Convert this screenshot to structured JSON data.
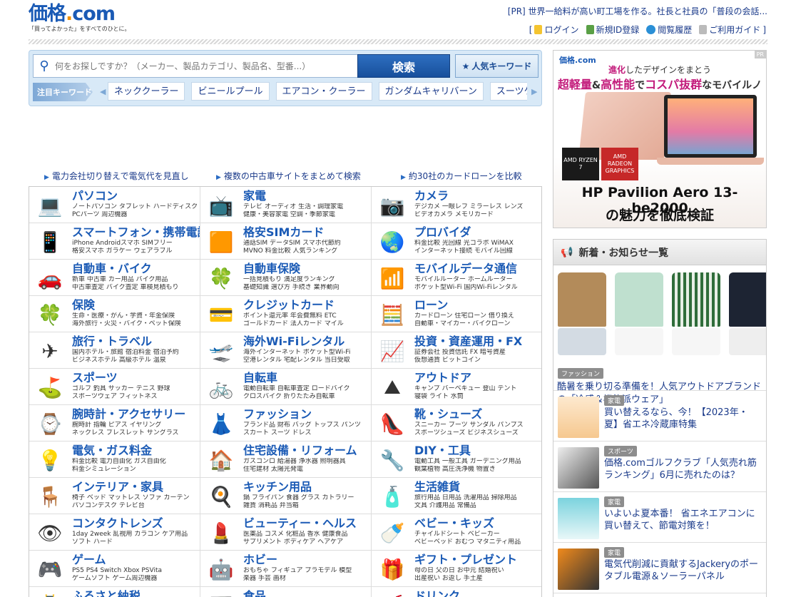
{
  "header": {
    "logo_text_a": "価格",
    "logo_text_dot": ".",
    "logo_text_b": "com",
    "logo_tagline": "「買ってよかった」をすべてのひとに。",
    "pr_link": "[PR] 世界一給料が高い町工場を作る。社長と社員の「普段の会話...",
    "util_links": [
      "ログイン",
      "新規ID登録",
      "閲覧履歴",
      "ご利用ガイド"
    ],
    "util_brackets": [
      "[",
      "]"
    ]
  },
  "search": {
    "placeholder": "何をお探しですか？（メーカー、製品カテゴリ、製品名、型番...）",
    "button": "検索",
    "popular_button": "人気キーワード",
    "hot_label": "注目キーワード",
    "keywords": [
      "ネッククーラー",
      "ビニールプール",
      "エアコン・クーラー",
      "ガンダムキャリバーン",
      "スーツケース・キャリーバッグ"
    ]
  },
  "promos": [
    "電力会社切り替えで電気代を見直し",
    "複数の中古車サイトをまとめて検索",
    "約30社のカードローンを比較"
  ],
  "categories": [
    {
      "title": "パソコン",
      "sub1": "ノートパソコン  タブレット  ハードディスク",
      "sub2": "PCパーツ  周辺機器",
      "icon": "laptop-icon",
      "glyph": "💻"
    },
    {
      "title": "家電",
      "sub1": "テレビ  オーディオ  生活・調理家電",
      "sub2": "健康・美容家電  空調・季節家電",
      "icon": "appliance-icon",
      "glyph": "📺"
    },
    {
      "title": "カメラ",
      "sub1": "デジカメ  一眼レフ  ミラーレス  レンズ",
      "sub2": "ビデオカメラ  メモリカード",
      "icon": "camera-icon",
      "glyph": "📷"
    },
    {
      "title": "スマートフォン・携帯電話",
      "sub1": "iPhone  Androidスマホ  SIMフリー",
      "sub2": "格安スマホ  ガラケー  ウェアラブル",
      "icon": "smartphone-icon",
      "glyph": "📱"
    },
    {
      "title": "格安SIMカード",
      "sub1": "通話SIM  データSIM  スマホ代節約",
      "sub2": "MVNO  料金比較  人気ランキング",
      "icon": "sim-card-icon",
      "glyph": "🟧"
    },
    {
      "title": "プロバイダ",
      "sub1": "料金比較  光回線  光コラボ  WiMAX",
      "sub2": "インターネット接続  モバイル回線",
      "icon": "globe-icon",
      "glyph": "🌏"
    },
    {
      "title": "自動車・バイク",
      "sub1": "新車  中古車  カー用品  バイク用品",
      "sub2": "中古車査定  バイク査定  車検見積もり",
      "icon": "car-icon",
      "glyph": "🚗"
    },
    {
      "title": "自動車保険",
      "sub1": "一括見積もり  満足度ランキング",
      "sub2": "基礎知識  選び方  手続き  業界動向",
      "icon": "car-insurance-icon",
      "glyph": "🍀"
    },
    {
      "title": "モバイルデータ通信",
      "sub1": "モバイルルーター  ホームルーター",
      "sub2": "ポケット型Wi-Fi  国内Wi-Fiレンタル",
      "icon": "wifi-icon",
      "glyph": "📶"
    },
    {
      "title": "保険",
      "sub1": "生命・医療・がん・学資・年金保険",
      "sub2": "海外旅行・火災・バイク・ペット保険",
      "icon": "clover-icon",
      "glyph": "🍀"
    },
    {
      "title": "クレジットカード",
      "sub1": "ポイント還元率  年会費無料  ETC",
      "sub2": "ゴールドカード  法人カード  マイル",
      "icon": "credit-card-icon",
      "glyph": "💳"
    },
    {
      "title": "ローン",
      "sub1": "カードローン  住宅ローン  借り換え",
      "sub2": "自動車・マイカー・バイクローン",
      "icon": "calculator-icon",
      "glyph": "🧮"
    },
    {
      "title": "旅行・トラベル",
      "sub1": "国内ホテル・旅館  宿泊料金  宿泊予約",
      "sub2": "ビジネスホテル  高級ホテル  温泉",
      "icon": "airplane-icon",
      "glyph": "✈"
    },
    {
      "title": "海外Wi-Fiレンタル",
      "sub1": "海外インターネット  ポケット型Wi-Fi",
      "sub2": "空港レンタル  宅配レンタル  当日受取",
      "icon": "wifi-plane-icon",
      "glyph": "🛫"
    },
    {
      "title": "投資・資産運用・FX",
      "sub1": "証券会社  投資信託  FX  暗号資産",
      "sub2": "仮想通貨  ビットコイン",
      "icon": "chart-icon",
      "glyph": "📈"
    },
    {
      "title": "スポーツ",
      "sub1": "ゴルフ  釣具  サッカー  テニス  野球",
      "sub2": "スポーツウェア  フィットネス",
      "icon": "golf-icon",
      "glyph": "⛳"
    },
    {
      "title": "自転車",
      "sub1": "電動自転車  自転車査定  ロードバイク",
      "sub2": "クロスバイク  折りたたみ自転車",
      "icon": "bicycle-icon",
      "glyph": "🚲"
    },
    {
      "title": "アウトドア",
      "sub1": "キャンプ  バーベキュー  登山  テント",
      "sub2": "寝袋  ライト  水筒",
      "icon": "mountain-icon",
      "glyph": "⛰"
    },
    {
      "title": "腕時計・アクセサリー",
      "sub1": "腕時計  指輪  ピアス  イヤリング",
      "sub2": "ネックレス  ブレスレット  サングラス",
      "icon": "watch-icon",
      "glyph": "⌚"
    },
    {
      "title": "ファッション",
      "sub1": "ブランド品  財布  バッグ  トップス  パンツ",
      "sub2": "スカート  スーツ  ドレス",
      "icon": "dress-icon",
      "glyph": "👗"
    },
    {
      "title": "靴・シューズ",
      "sub1": "スニーカー  ブーツ  サンダル  パンプス",
      "sub2": "スポーツシューズ  ビジネスシューズ",
      "icon": "shoe-icon",
      "glyph": "👠"
    },
    {
      "title": "電気・ガス料金",
      "sub1": "料金比較  電力自由化  ガス自由化",
      "sub2": "料金シミュレーション",
      "icon": "bulb-icon",
      "glyph": "💡"
    },
    {
      "title": "住宅設備・リフォーム",
      "sub1": "ガスコンロ  給湯器  浄水器  照明器具",
      "sub2": "住宅建材  太陽光発電",
      "icon": "house-icon",
      "glyph": "🏠"
    },
    {
      "title": "DIY・工具",
      "sub1": "電動工具  一般工具  ガーデニング用品",
      "sub2": "観葉植物  高圧洗浄機  物置き",
      "icon": "drill-icon",
      "glyph": "🔧"
    },
    {
      "title": "インテリア・家具",
      "sub1": "椅子  ベッド  マットレス  ソファ  カーテン",
      "sub2": "パソコンデスク  テレビ台",
      "icon": "chair-icon",
      "glyph": "🪑"
    },
    {
      "title": "キッチン用品",
      "sub1": "鍋  フライパン  食器  グラス  カトラリー",
      "sub2": "雑貨  消耗品  弁当箱",
      "icon": "pot-icon",
      "glyph": "🍳"
    },
    {
      "title": "生活雑貨",
      "sub1": "旅行用品  日用品  洗濯用品  掃除用品",
      "sub2": "文具  介護用品  常備品",
      "icon": "spray-icon",
      "glyph": "🧴"
    },
    {
      "title": "コンタクトレンズ",
      "sub1": "1day  2week  乱視用  カラコン  ケア用品",
      "sub2": "ソフト  ハード",
      "icon": "contact-lens-icon",
      "glyph": "👁"
    },
    {
      "title": "ビューティー・ヘルス",
      "sub1": "医薬品  コスメ  化粧品  香水  健康食品",
      "sub2": "サプリメント  ボディケア  ヘアケア",
      "icon": "cosmetics-icon",
      "glyph": "💄"
    },
    {
      "title": "ベビー・キッズ",
      "sub1": "チャイルドシート  ベビーカー",
      "sub2": "ベビーベッド  おむつ  マタニティ用品",
      "icon": "stroller-icon",
      "glyph": "🍼"
    },
    {
      "title": "ゲーム",
      "sub1": "PS5  PS4  Switch  Xbox  PSVita",
      "sub2": "ゲームソフト  ゲーム周辺機器",
      "icon": "gamepad-icon",
      "glyph": "🎮"
    },
    {
      "title": "ホビー",
      "sub1": "おもちゃ  フィギュア  プラモデル  模型",
      "sub2": "楽器  手芸  画材",
      "icon": "robot-icon",
      "glyph": "🤖"
    },
    {
      "title": "ギフト・プレゼント",
      "sub1": "母の日  父の日  お中元  結婚祝い",
      "sub2": "出産祝い  お返し  手土産",
      "icon": "gift-icon",
      "glyph": "🎁"
    },
    {
      "title": "ふるさと納税",
      "sub1": "",
      "sub2": "",
      "icon": "furusato-icon",
      "glyph": "🏯"
    },
    {
      "title": "食品",
      "sub1": "",
      "sub2": "",
      "icon": "food-icon",
      "glyph": "🍱"
    },
    {
      "title": "ドリンク",
      "sub1": "",
      "sub2": "",
      "icon": "drink-icon",
      "glyph": "🥤"
    }
  ],
  "ad": {
    "pr": "PR",
    "logo": "価格.com",
    "line1_a": "進化",
    "line1_b": "したデザインをまとう",
    "line2_a": "超軽量",
    "line2_b": "&",
    "line2_c": "高性能",
    "line2_d": "で",
    "line2_e": "コスパ抜群",
    "line2_f": "なモバイルノート",
    "chip1": "AMD RYZEN 7",
    "chip2": "AMD RADEON GRAPHICS",
    "model": "HP Pavilion Aero 13-be2000",
    "model_sub": "の魅力を徹底検証"
  },
  "news": {
    "title": "新着・お知らせ一覧",
    "feature_tag": "ファッション",
    "feature_text": "酷暑を乗り切る準備を！人気アウトドアブランドの「冷感＆機能派ウェア」",
    "items": [
      {
        "tag": "家電",
        "title": "買い替えるなら、今！【2023年・夏】省エネ冷蔵庫特集"
      },
      {
        "tag": "スポーツ",
        "title": "価格.comゴルフクラブ「人気売れ筋ランキング」6月に売れたのは？"
      },
      {
        "tag": "家電",
        "title": "いよいよ夏本番！ 省エネエアコンに買い替えて、節電対策を！"
      },
      {
        "tag": "家電",
        "title": "電気代削減に貢献するJackeryのポータブル電源＆ソーラーパネル"
      }
    ]
  },
  "colors": {
    "brand_blue": "#1a5ab5",
    "accent_orange": "#f09000",
    "link_blue": "#1a3a8a"
  }
}
